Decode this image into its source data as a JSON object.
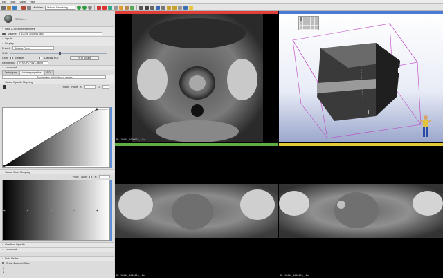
{
  "menu": [
    "File",
    "Edit",
    "View",
    "Help"
  ],
  "toolbar": {
    "modules_label": "Modules:",
    "module_selected": "Volume Rendering"
  },
  "panel": {
    "logo_text": "3DSlicer",
    "help_section": "Help & Acknowledgement",
    "volume_label": "Volume:",
    "volume_value": "10016_1000016_adc",
    "inputs_section": "Inputs",
    "display_section": "Display",
    "preset_label": "Preset:",
    "preset_value": "Select a Preset",
    "shift_label": "Shift:",
    "crop_label": "Crop:",
    "enable_label": "Enable",
    "display_roi_label": "Display ROI",
    "fit_button": "Fit to Volume",
    "rendering_label": "Rendering:",
    "rendering_value": "VTK GPU Ray Casting",
    "advanced_section": "Advanced",
    "tabs": [
      "Techniques",
      "Volume properties",
      "ROI"
    ],
    "sync_value": "Synchronize with Volumes module",
    "scalar_opacity_section": "Scalar Opacity Mapping",
    "point_label": "Point:",
    "point_value": "None",
    "x_label": "X:",
    "o_label": "O:",
    "scalar_color_section": "Scalar Color Mapping",
    "gradient_section": "Gradient Opacity",
    "advanced2_section": "Advanced",
    "data_probe_section": "Data Probe",
    "show_zoomed_label": "Show Zoomed Slice",
    "probe_lines": [
      "L",
      "F",
      "B"
    ]
  },
  "views": {
    "red_label": "B: 10016_1000016_t2w",
    "green_label": "B: 10016_1000016_t2w",
    "yellow_label": "B: 10016_1000016_t2w",
    "axis_S": "S",
    "axis_L": "L",
    "axis_I": "I"
  },
  "colors": {
    "red": "#e0403a",
    "green": "#5fae44",
    "yellow": "#e2c938",
    "blue": "#4a7bd8"
  }
}
